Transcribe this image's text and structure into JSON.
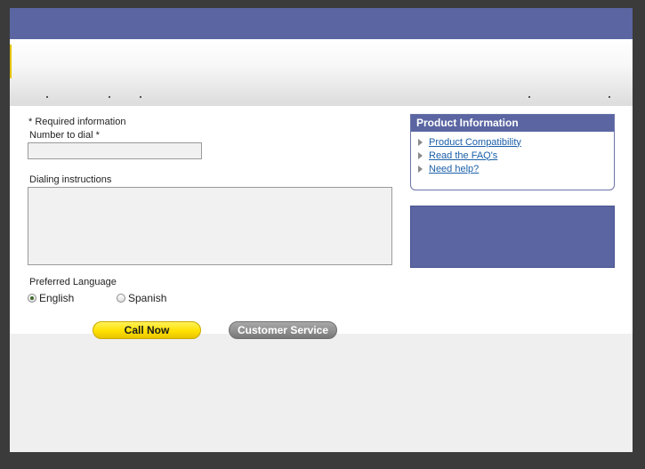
{
  "form": {
    "required_note": "*  Required information",
    "number_label": "Number to dial *",
    "number_value": "",
    "instructions_label": "Dialing instructions",
    "instructions_value": "",
    "language_label": "Preferred Language",
    "languages": [
      {
        "label": "English",
        "selected": true
      },
      {
        "label": "Spanish",
        "selected": false
      }
    ],
    "call_button": "Call Now",
    "customer_service_button": "Customer Service"
  },
  "product_info": {
    "title": "Product Information",
    "links": [
      "Product Compatibility",
      "Read the FAQ's",
      "Need help?"
    ]
  },
  "colors": {
    "header_blue": "#5a65a2",
    "call_yellow": "#ffe100",
    "link_blue": "#1a5fa8"
  }
}
